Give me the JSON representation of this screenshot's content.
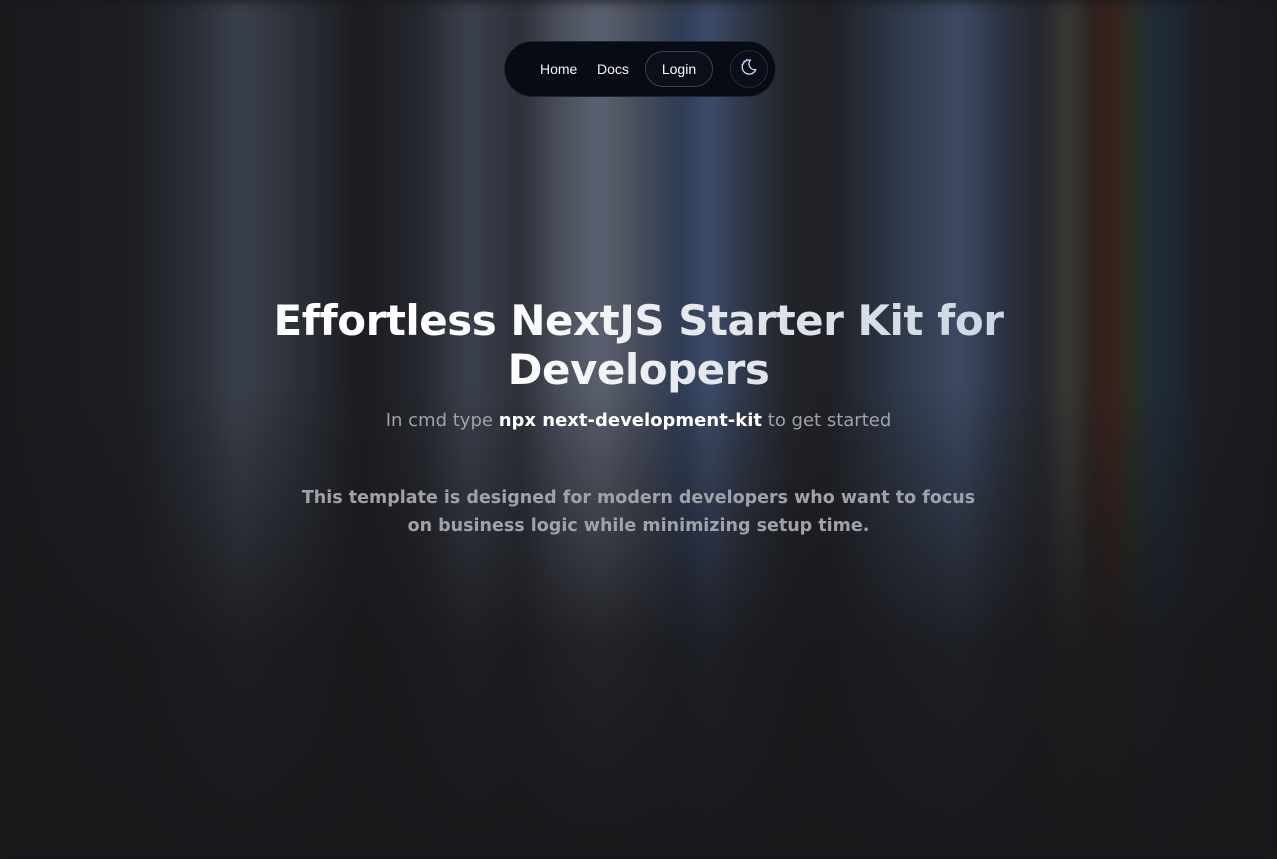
{
  "nav": {
    "home_label": "Home",
    "docs_label": "Docs",
    "login_label": "Login",
    "theme_toggle_icon": "moon-stars-icon"
  },
  "hero": {
    "title_line1": "Effortless NextJS Starter Kit for",
    "title_line2": "Developers",
    "subtitle_prefix": "In cmd type",
    "subtitle_command": "npx next-development-kit",
    "subtitle_suffix": "to get started",
    "description": "This template is designed for modern developers who want to focus on business logic while minimizing setup time."
  },
  "colors": {
    "background": "#18181b",
    "nav_background": "#070b14",
    "muted_text": "#a1a1aa",
    "text": "#ffffff"
  }
}
